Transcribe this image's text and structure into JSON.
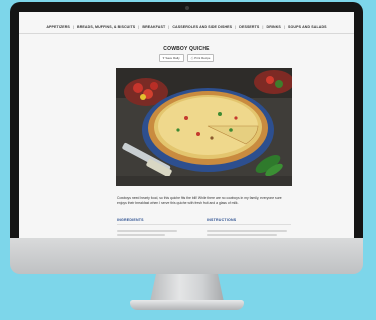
{
  "nav": {
    "items": [
      "APPETIZERS",
      "BREADS, MUFFINS, & BISCUITS",
      "BREAKFAST",
      "CASSEROLES AND SIDE DISHES",
      "DESSERTS",
      "DRINKS",
      "SOUPS AND SALADS"
    ]
  },
  "recipe": {
    "title": "COWBOY QUICHE",
    "actions": {
      "save_label": "Save Rally",
      "print_label": "Print Recipe"
    },
    "intro": "Cowboys need hearty food, so this quiche fits the bill! While there are no cowboys in my family, everyone sure enjoys their breakfast when I serve this quiche with fresh fruit and a glass of milk.",
    "ingredients_heading": "INGREDIENTS",
    "instructions_heading": "INSTRUCTIONS"
  },
  "colors": {
    "background": "#7dd6ea",
    "heading_accent": "#2a4e8f"
  },
  "icons": {
    "save": "heart-icon",
    "print": "printer-icon"
  }
}
